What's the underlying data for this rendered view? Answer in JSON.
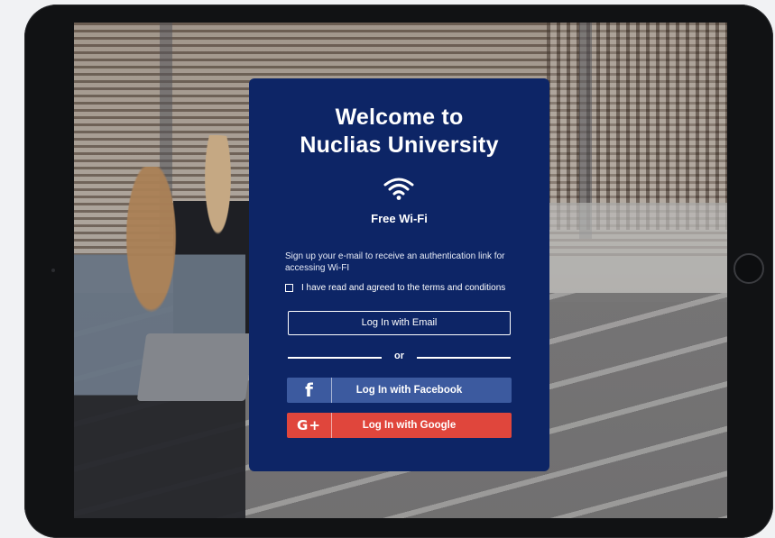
{
  "card": {
    "title_line1": "Welcome to",
    "title_line2": "Nuclias University",
    "wifi_label": "Free Wi-Fi",
    "description": "Sign up your e-mail to receive an authentication link for accessing Wi-FI",
    "terms_label": "I have read and agreed to the terms and conditions",
    "email_button": "Log In with Email",
    "divider_text": "or",
    "facebook_button": "Log In with Facebook",
    "google_button": "Log In with Google",
    "facebook_icon_glyph": "f",
    "google_icon_glyph": "G+"
  },
  "icons": {
    "wifi": "wifi-icon",
    "facebook": "facebook-icon",
    "google": "google-plus-icon"
  },
  "colors": {
    "card_background": "#0d2566",
    "facebook": "#3c5a9f",
    "google": "#e0463c"
  },
  "terms_checked": false
}
